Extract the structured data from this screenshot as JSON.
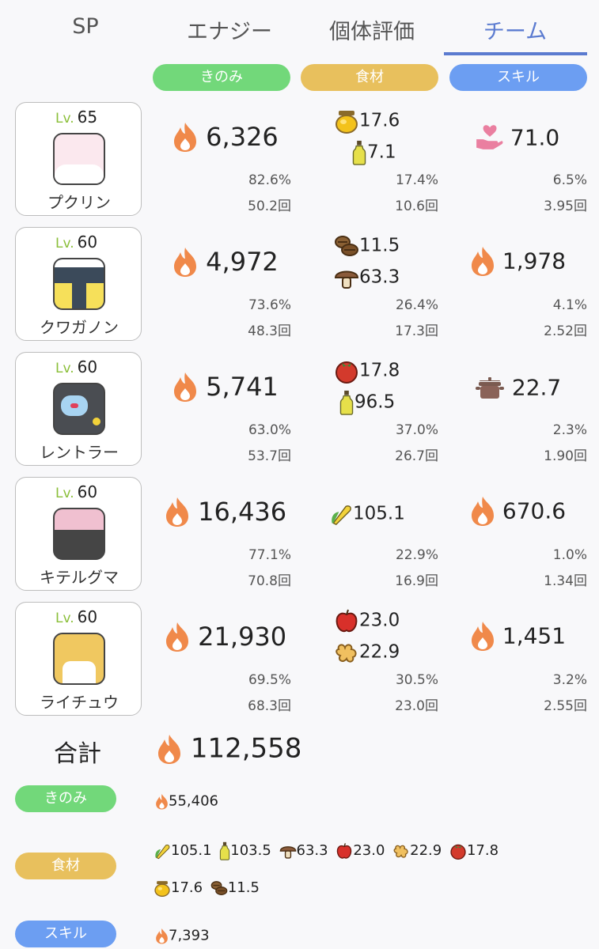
{
  "tabs": [
    {
      "label": "SP"
    },
    {
      "label": "エナジー"
    },
    {
      "label": "個体評価"
    },
    {
      "label": "チーム"
    }
  ],
  "active_tab": "チーム",
  "columns": {
    "berry": "きのみ",
    "ingredient": "食材",
    "skill": "スキル"
  },
  "level_prefix": "Lv.",
  "members": [
    {
      "level": "65",
      "name": "プクリン",
      "berry_energy": "6,326",
      "ingredients": [
        {
          "icon": "honey-icon",
          "value": "17.6"
        },
        {
          "icon": "oil-icon",
          "value": "7.1"
        }
      ],
      "skill_icon": "heart-hand-icon",
      "skill_value": "71.0",
      "berry_pct": "82.6%",
      "berry_count": "50.2回",
      "ing_pct": "17.4%",
      "ing_count": "10.6回",
      "skill_pct": "6.5%",
      "skill_count": "3.95回"
    },
    {
      "level": "60",
      "name": "クワガノン",
      "berry_energy": "4,972",
      "ingredients": [
        {
          "icon": "cacao-icon",
          "value": "11.5"
        },
        {
          "icon": "mushroom-icon",
          "value": "63.3"
        }
      ],
      "skill_icon": "flame-icon",
      "skill_value": "1,978",
      "berry_pct": "73.6%",
      "berry_count": "48.3回",
      "ing_pct": "26.4%",
      "ing_count": "17.3回",
      "skill_pct": "4.1%",
      "skill_count": "2.52回"
    },
    {
      "level": "60",
      "name": "レントラー",
      "berry_energy": "5,741",
      "ingredients": [
        {
          "icon": "tomato-icon",
          "value": "17.8"
        },
        {
          "icon": "oil-icon",
          "value": "96.5"
        }
      ],
      "skill_icon": "pot-icon",
      "skill_value": "22.7",
      "berry_pct": "63.0%",
      "berry_count": "53.7回",
      "ing_pct": "37.0%",
      "ing_count": "26.7回",
      "skill_pct": "2.3%",
      "skill_count": "1.90回"
    },
    {
      "level": "60",
      "name": "キテルグマ",
      "berry_energy": "16,436",
      "ingredients": [
        {
          "icon": "corn-icon",
          "value": "105.1"
        }
      ],
      "skill_icon": "flame-icon",
      "skill_value": "670.6",
      "berry_pct": "77.1%",
      "berry_count": "70.8回",
      "ing_pct": "22.9%",
      "ing_count": "16.9回",
      "skill_pct": "1.0%",
      "skill_count": "1.34回"
    },
    {
      "level": "60",
      "name": "ライチュウ",
      "berry_energy": "21,930",
      "ingredients": [
        {
          "icon": "apple-icon",
          "value": "23.0"
        },
        {
          "icon": "ginger-icon",
          "value": "22.9"
        }
      ],
      "skill_icon": "flame-icon",
      "skill_value": "1,451",
      "berry_pct": "69.5%",
      "berry_count": "68.3回",
      "ing_pct": "30.5%",
      "ing_count": "23.0回",
      "skill_pct": "3.2%",
      "skill_count": "2.55回"
    }
  ],
  "total": {
    "label": "合計",
    "value": "112,558"
  },
  "summary": {
    "berry": {
      "label": "きのみ",
      "value": "55,406"
    },
    "ingredient": {
      "label": "食材",
      "items": [
        {
          "icon": "corn-icon",
          "value": "105.1"
        },
        {
          "icon": "oil-icon",
          "value": "103.5"
        },
        {
          "icon": "mushroom-icon",
          "value": "63.3"
        },
        {
          "icon": "apple-icon",
          "value": "23.0"
        },
        {
          "icon": "ginger-icon",
          "value": "22.9"
        },
        {
          "icon": "tomato-icon",
          "value": "17.8"
        },
        {
          "icon": "honey-icon",
          "value": "17.6"
        },
        {
          "icon": "cacao-icon",
          "value": "11.5"
        }
      ]
    },
    "skill": {
      "label": "スキル",
      "value": "7,393"
    }
  },
  "colors": {
    "accent": "#5b7bd0",
    "berry_pill": "#72d87a",
    "ingredient_pill": "#e8c05d",
    "skill_pill": "#6c9ef2",
    "flame": "#f0894a"
  }
}
